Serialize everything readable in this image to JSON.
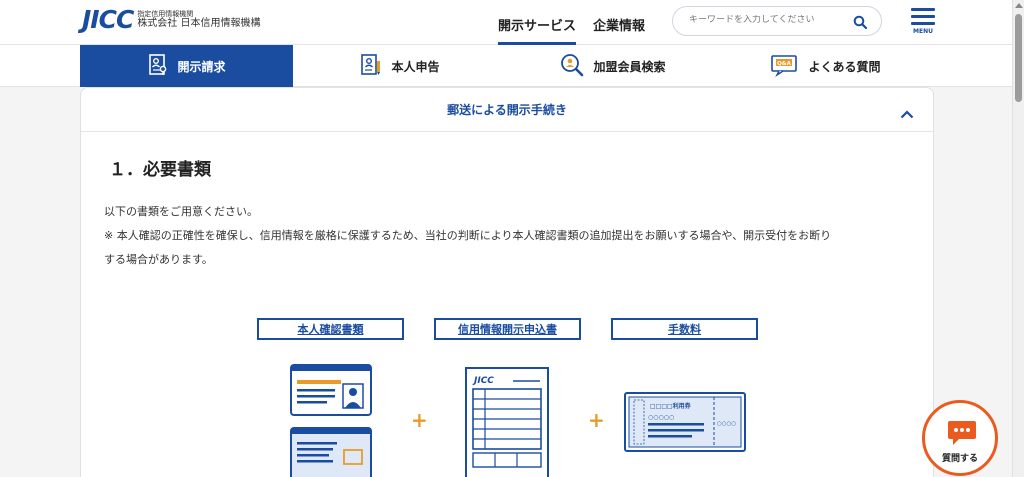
{
  "header": {
    "logo_mark": "JICC",
    "logo_sub": "指定信用情報機関",
    "logo_name": "株式会社 日本信用情報機構",
    "nav": [
      {
        "label": "開示サービス",
        "active": true
      },
      {
        "label": "企業情報",
        "active": false
      }
    ],
    "search_placeholder": "キーワードを入力してください",
    "menu_label": "MENU"
  },
  "tabs": [
    {
      "label": "開示請求",
      "icon": "person-document-icon",
      "active": true
    },
    {
      "label": "本人申告",
      "icon": "document-pen-icon",
      "active": false
    },
    {
      "label": "加盟会員検索",
      "icon": "magnifier-person-icon",
      "active": false
    },
    {
      "label": "よくある質問",
      "icon": "qa-chat-icon",
      "active": false
    }
  ],
  "accordion": {
    "title": "郵送による開示手続き"
  },
  "section": {
    "title": "１．必要書類",
    "line1": "以下の書類をご用意ください。",
    "line2": "※ 本人確認の正確性を確保し、信用情報を厳格に保護するため、当社の判断により本人確認書類の追加提出をお願いする場合や、開示受付をお断り",
    "line3": "する場合があります。"
  },
  "documents": [
    {
      "label": "本人確認書類"
    },
    {
      "label": "信用情報開示申込書"
    },
    {
      "label": "手数料"
    }
  ],
  "form_logo": "JICC",
  "ticket_text": "□□□□利用券",
  "ticket_code": "○○○○○",
  "ticket_side": "○○○○",
  "chat_label": "質問する",
  "colors": {
    "brand": "#1a4da0",
    "accent": "#e89b2a",
    "chat": "#ea5b1f"
  }
}
